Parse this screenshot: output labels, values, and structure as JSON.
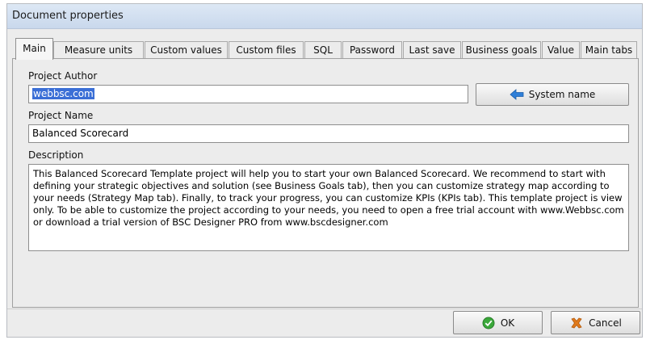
{
  "window": {
    "title": "Document properties"
  },
  "tabs": [
    {
      "label": "Main",
      "active": true
    },
    {
      "label": "Measure units",
      "active": false
    },
    {
      "label": "Custom values",
      "active": false
    },
    {
      "label": "Custom files",
      "active": false
    },
    {
      "label": "SQL",
      "active": false
    },
    {
      "label": "Password",
      "active": false
    },
    {
      "label": "Last save",
      "active": false
    },
    {
      "label": "Business goals",
      "active": false
    },
    {
      "label": "Value",
      "active": false
    },
    {
      "label": "Main tabs",
      "active": false
    }
  ],
  "main": {
    "project_author_label": "Project Author",
    "project_author_value": "webbsc.com",
    "system_name_button": "System name",
    "project_name_label": "Project Name",
    "project_name_value": "Balanced Scorecard",
    "description_label": "Description",
    "description_value": "This Balanced Scorecard Template project will help you to start your own Balanced Scorecard.   We recommend to start with defining your strategic objectives and solution (see Business Goals tab), then you can customize strategy map according to your needs (Strategy Map tab). Finally, to track your progress, you can customize KPIs (KPIs tab).  This template project is view only. To be able to customize the project according to your needs, you need to open a free trial account with www.Webbsc.com or download a trial version of BSC Designer PRO from www.bscdesigner.com"
  },
  "footer": {
    "ok_label": "OK",
    "cancel_label": "Cancel"
  },
  "colors": {
    "selection": "#3b6fd6",
    "ok_icon": "#3aa83a",
    "cancel_icon": "#e07a1c",
    "arrow_icon": "#2f7fd8"
  },
  "icons": {
    "system_name": "arrow-left-icon",
    "ok": "check-circle-icon",
    "cancel": "cross-icon"
  }
}
